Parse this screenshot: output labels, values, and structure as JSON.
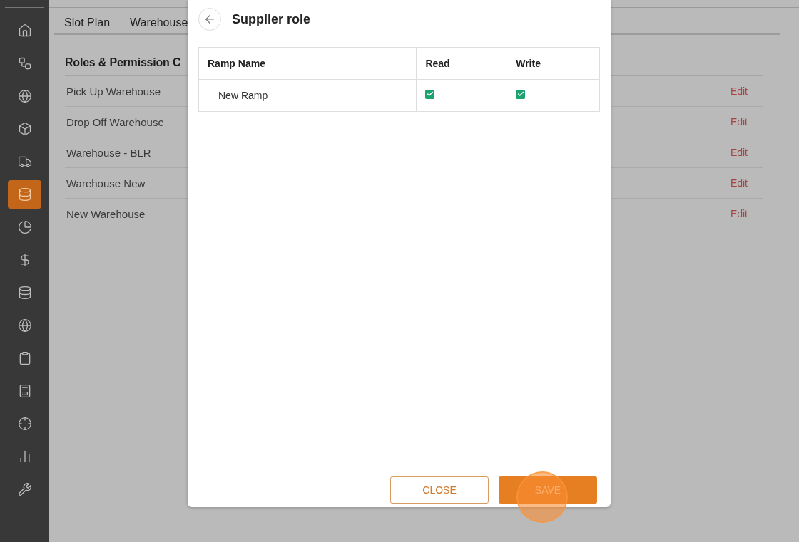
{
  "sidebar": {
    "items": [
      {
        "kind": "home",
        "selected": false
      },
      {
        "kind": "network",
        "selected": false
      },
      {
        "kind": "globe",
        "selected": false
      },
      {
        "kind": "box",
        "selected": false
      },
      {
        "kind": "truck",
        "selected": false
      },
      {
        "kind": "database",
        "selected": true
      },
      {
        "kind": "pie",
        "selected": false
      },
      {
        "kind": "dollar",
        "selected": false
      },
      {
        "kind": "database",
        "selected": false
      },
      {
        "kind": "globe",
        "selected": false
      },
      {
        "kind": "clipboard",
        "selected": false
      },
      {
        "kind": "calculator",
        "selected": false
      },
      {
        "kind": "target",
        "selected": false
      },
      {
        "kind": "chart",
        "selected": false
      },
      {
        "kind": "tools",
        "selected": false
      }
    ]
  },
  "tabs": [
    {
      "label": "Slot Plan"
    },
    {
      "label": "Warehouse"
    }
  ],
  "section_title": "Roles & Permission C",
  "warehouses": [
    {
      "name": "Pick Up Warehouse",
      "action": "Edit"
    },
    {
      "name": "Drop Off Warehouse",
      "action": "Edit"
    },
    {
      "name": "Warehouse - BLR",
      "action": "Edit"
    },
    {
      "name": "Warehouse New",
      "action": "Edit"
    },
    {
      "name": "New Warehouse",
      "action": "Edit"
    }
  ],
  "dialog": {
    "title": "Supplier role",
    "columns": [
      "Ramp Name",
      "Read",
      "Write"
    ],
    "rows": [
      {
        "name": "New Ramp",
        "read": true,
        "write": true
      }
    ],
    "buttons": [
      {
        "label": "CLOSE",
        "kind": "outline"
      },
      {
        "label": "SAVE",
        "kind": "primary"
      }
    ]
  }
}
